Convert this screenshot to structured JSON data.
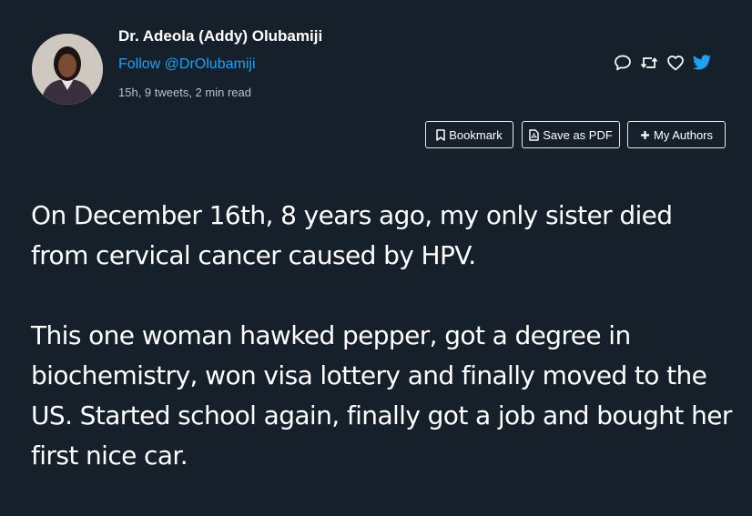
{
  "author": {
    "name": "Dr. Adeola (Addy) Olubamiji",
    "follow_text": "Follow @DrOlubamiji",
    "meta": "15h, 9 tweets, 2 min read"
  },
  "action_icons": [
    "comment-icon",
    "retweet-icon",
    "heart-icon",
    "twitter-bird-icon"
  ],
  "buttons": {
    "bookmark": "Bookmark",
    "save_pdf": "Save as PDF",
    "my_authors": "My Authors"
  },
  "tweet": {
    "paragraphs": [
      "On December 16th, 8 years ago, my only sister died from cervical cancer caused by HPV.",
      "This one woman hawked pepper, got a degree in biochemistry, won visa lottery and finally moved to the US. Started school again, finally got a job and bought her first nice car."
    ]
  },
  "colors": {
    "background": "#15202b",
    "link": "#1da1f2",
    "text": "#ffffff",
    "muted": "#b9c1c9"
  }
}
